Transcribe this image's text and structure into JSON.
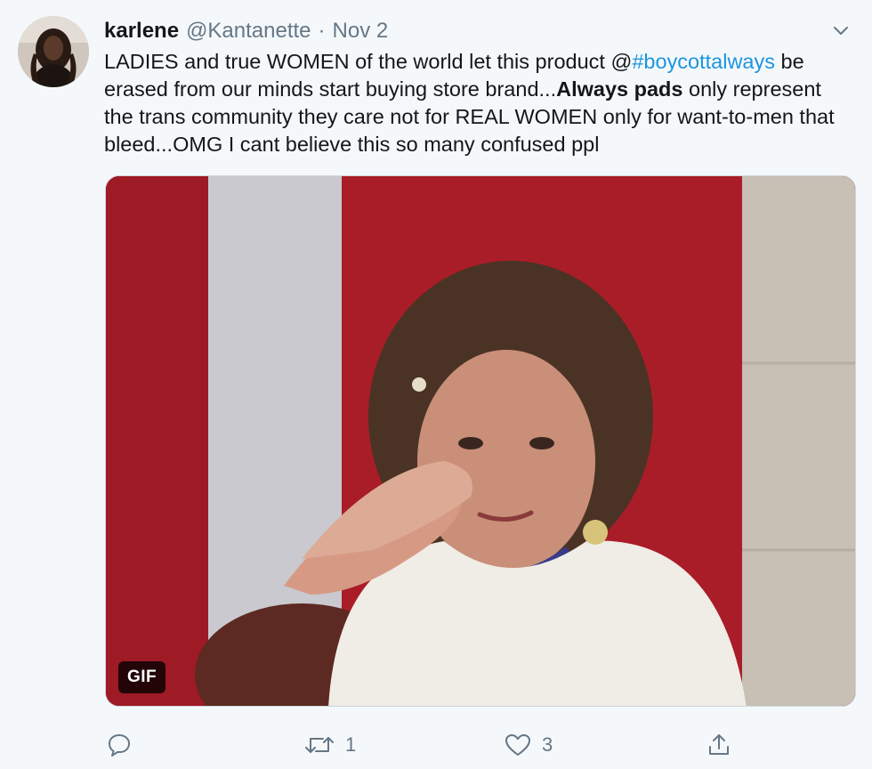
{
  "tweet": {
    "author": {
      "name": "karlene",
      "handle": "@Kantanette",
      "separator": "·",
      "date": "Nov 2"
    },
    "text": {
      "part1": "LADIES and true WOMEN of the world let this product @",
      "hashtag": "#boycottalways",
      "part2": " be erased from our minds start buying store brand...",
      "bold": "Always pads",
      "part3": " only represent the trans community they care not for REAL WOMEN only for want-to-men that bleed...OMG I cant believe this so many confused ppl"
    },
    "media": {
      "badge": "GIF"
    },
    "actions": {
      "reply_icon": "reply-icon",
      "retweet_icon": "retweet-icon",
      "retweet_count": "1",
      "like_icon": "heart-icon",
      "like_count": "3",
      "share_icon": "share-icon"
    }
  },
  "colors": {
    "link": "#1b95e0",
    "muted": "#657786",
    "background": "#f5f8fa"
  }
}
